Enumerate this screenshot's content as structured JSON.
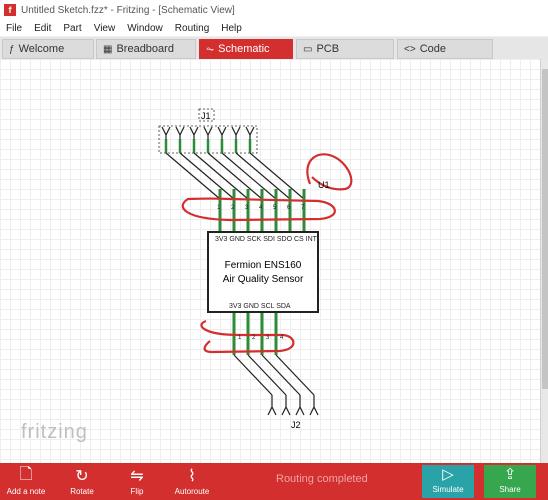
{
  "window": {
    "title": "Untitled Sketch.fzz* - Fritzing - [Schematic View]"
  },
  "menu": [
    "File",
    "Edit",
    "Part",
    "View",
    "Window",
    "Routing",
    "Help"
  ],
  "tabs": [
    {
      "label": "Welcome",
      "icon": "f-icon"
    },
    {
      "label": "Breadboard",
      "icon": "breadboard-icon"
    },
    {
      "label": "Schematic",
      "icon": "schematic-icon"
    },
    {
      "label": "PCB",
      "icon": "pcb-icon"
    },
    {
      "label": "Code",
      "icon": "code-icon"
    }
  ],
  "canvas": {
    "j1_label": "J1",
    "u1_label": "U1",
    "j2_label": "J2",
    "j1_pin_numbers": [
      "1",
      "2",
      "3",
      "4",
      "5",
      "6",
      "7"
    ],
    "j2_pin_numbers": [
      "1",
      "2",
      "3",
      "4"
    ],
    "component": {
      "name_line1": "Fermion ENS160",
      "name_line2": "Air Quality Sensor",
      "top_pins": "3V3 GND SCK SDI SDO CS INT",
      "bottom_pins": "3V3 GND SCL SDA"
    },
    "logo": "fritzing",
    "wire_color": "#2e8b3a",
    "annotation_color": "#d32f2f"
  },
  "toolbar": {
    "add_note": "Add a note",
    "rotate": "Rotate",
    "flip": "Flip",
    "autoroute": "Autoroute",
    "status": "Routing completed",
    "simulate": "Simulate",
    "share": "Share"
  }
}
